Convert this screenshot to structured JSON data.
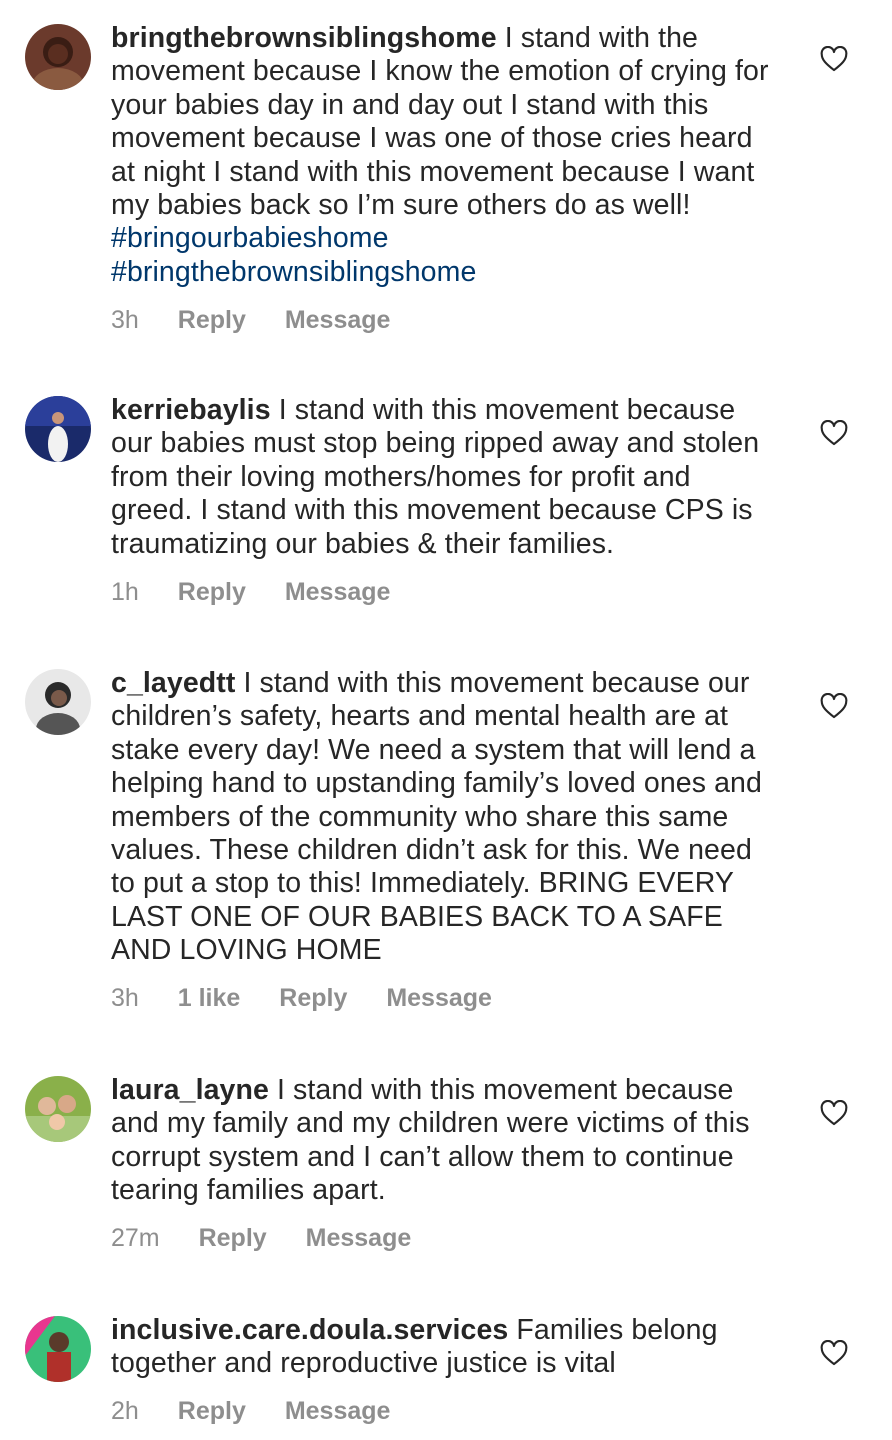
{
  "comments": [
    {
      "username": "bringthebrownsiblingshome",
      "text": "I stand with the movement because I know the emotion of crying for your babies day in and day out I stand with this movement because I was one of those cries heard at night I stand with this movement because I want my babies back so I’m sure others do as well!",
      "hashtags": [
        "#bringourbabieshome",
        "#bringthebrownsiblingshome"
      ],
      "time": "3h",
      "reply_label": "Reply",
      "message_label": "Message"
    },
    {
      "username": "kerriebaylis",
      "text": "I stand with this movement because our babies must stop being ripped away and stolen from their loving mothers/homes for profit and greed.  I stand with this movement because CPS is traumatizing our babies & their families.",
      "time": "1h",
      "reply_label": "Reply",
      "message_label": "Message"
    },
    {
      "username": "c_layedtt",
      "text": "I stand with this movement because our children’s safety, hearts and mental health are at stake every day! We need a system that will lend a helping hand to upstanding family’s loved ones and members of the community who share this same values. These children didn’t ask for this. We need to put a stop to this! Immediately. BRING EVERY LAST ONE OF OUR BABIES BACK TO A SAFE AND LOVING HOME",
      "time": "3h",
      "likes": "1 like",
      "reply_label": "Reply",
      "message_label": "Message"
    },
    {
      "username": "laura_layne",
      "text": "I stand with this movement because and my family and my children were victims of this corrupt system and I can’t allow them to continue tearing families apart.",
      "time": "27m",
      "reply_label": "Reply",
      "message_label": "Message"
    },
    {
      "username": "inclusive.care.doula.services",
      "text": "Families belong together and reproductive justice is vital",
      "time": "2h",
      "reply_label": "Reply",
      "message_label": "Message"
    }
  ],
  "icons": {
    "like": "heart-outline-icon",
    "avatar": "user-avatar"
  },
  "colors": {
    "text": "#262626",
    "meta": "#8e8e8e",
    "hashtag": "#00376b"
  }
}
